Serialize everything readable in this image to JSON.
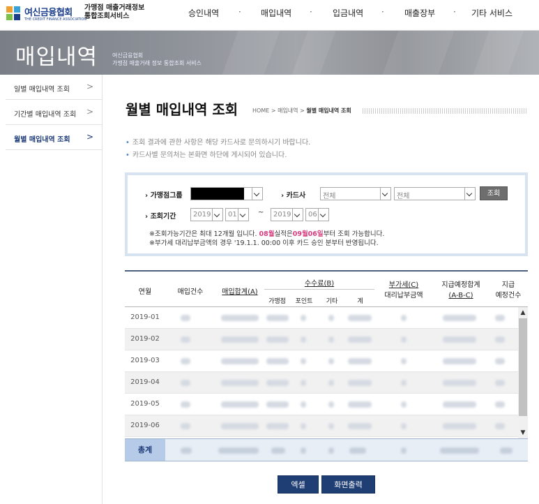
{
  "logo": {
    "name": "여신금융협회",
    "sub": "THE CREDIT FINANCE ASSOCIATION"
  },
  "site_title": {
    "line1": "가맹점 매출거래정보",
    "line2": "통합조회서비스"
  },
  "gnb": [
    "승인내역",
    "매입내역",
    "입금내역",
    "매출장부",
    "기타 서비스"
  ],
  "gnb_separator": "·",
  "banner": {
    "title": "매입내역",
    "sub1": "여신금융협회",
    "sub2": "가맹점 매출거래 정보 통합조회 서비스"
  },
  "sidebar": [
    {
      "label": "일별 매입내역 조회",
      "arrow": ">"
    },
    {
      "label": "기간별 매입내역 조회",
      "arrow": ">"
    },
    {
      "label": "월별 매입내역 조회",
      "arrow": ">"
    }
  ],
  "page_title": "월별 매입내역 조회",
  "breadcrumb": {
    "home": "HOME",
    "sep": ">",
    "level1": "매입내역",
    "current": "월별 매입내역 조회"
  },
  "notices": [
    "조회 결과에 관한 사항은 해당 카드사로 문의하시기 바랍니다.",
    "카드사별 문의처는 본화면 하단에 게시되어 있습니다."
  ],
  "search": {
    "merchant_group_label": "가맹점그룹",
    "card_company_label": "카드사",
    "card_company_select1": "전체",
    "card_company_select2": "전체",
    "search_button": "조회",
    "period_label": "조회기간",
    "from_year": "2019",
    "from_month": "01",
    "tilde": "~",
    "to_year": "2019",
    "to_month": "06",
    "note1_a": "※조회가능기간은 최대 12개월 입니다. ",
    "note1_b": "08월",
    "note1_c": "실적은",
    "note1_d": "09월06일",
    "note1_e": "부터 조회 가능합니다.",
    "note2": "※부가세 대리납부금액의 경우 '19.1.1. 00:00 이후 카드 승인 분부터 반영됩니다."
  },
  "table": {
    "headers": {
      "month": "연월",
      "count": "매입건수",
      "total": "매입합계(A)",
      "fee": "수수료(B)",
      "fee_sub": [
        "가맹점",
        "포인트",
        "기타",
        "계"
      ],
      "vat_line1": "부가세(C)",
      "vat_line2": "대리납부금액",
      "expected_line1": "지급예정합계",
      "expected_line2": "(A-B-C)",
      "paycount_line1": "지급",
      "paycount_line2": "예정건수"
    },
    "months": [
      "2019-01",
      "2019-02",
      "2019-03",
      "2019-04",
      "2019-05",
      "2019-06"
    ],
    "total_label": "총계"
  },
  "buttons": {
    "excel": "엑셀",
    "print": "화면출력"
  },
  "colors": {
    "accent_navy": "#1f3e74",
    "highlight_pink": "#d63c7e",
    "search_border": "#d7e3f1"
  }
}
